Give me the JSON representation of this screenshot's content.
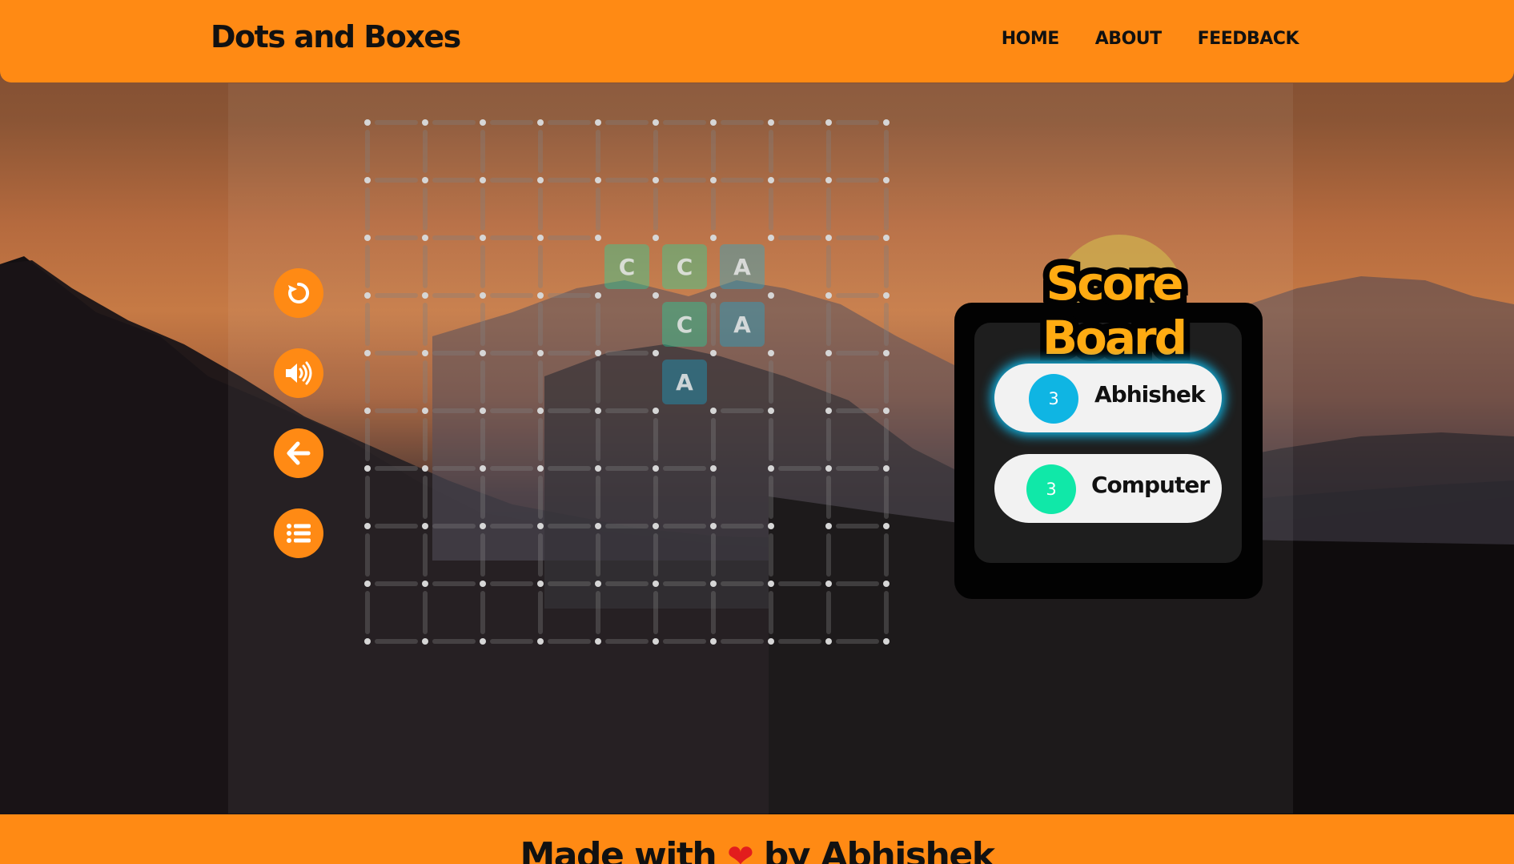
{
  "header": {
    "brand": "Dots and Boxes",
    "nav": [
      "HOME",
      "ABOUT",
      "FEEDBACK"
    ]
  },
  "side_controls": [
    {
      "name": "restart-button",
      "icon": "undo-icon"
    },
    {
      "name": "sound-button",
      "icon": "volume-icon"
    },
    {
      "name": "back-button",
      "icon": "arrow-left-icon"
    },
    {
      "name": "menu-button",
      "icon": "list-icon"
    }
  ],
  "colors": {
    "accent": "#ff8a14",
    "player_one": "#0fb5e3",
    "player_two": "#10e8a8",
    "title": "#ffab12"
  },
  "board": {
    "dots_per_side": 10,
    "horizontal_lines": [
      {
        "row": 2,
        "col": 4,
        "owner": "C"
      },
      {
        "row": 2,
        "col": 5,
        "owner": "C"
      },
      {
        "row": 2,
        "col": 6,
        "owner": "A"
      },
      {
        "row": 3,
        "col": 4,
        "owner": "C"
      },
      {
        "row": 3,
        "col": 5,
        "owner": "C"
      },
      {
        "row": 3,
        "col": 6,
        "owner": "A"
      },
      {
        "row": 3,
        "col": 7,
        "owner": "C"
      },
      {
        "row": 4,
        "col": 5,
        "owner": "A"
      },
      {
        "row": 4,
        "col": 6,
        "owner": "A"
      },
      {
        "row": 4,
        "col": 7,
        "owner": "A"
      },
      {
        "row": 5,
        "col": 5,
        "owner": "A"
      },
      {
        "row": 5,
        "col": 7,
        "owner": "C"
      },
      {
        "row": 6,
        "col": 6,
        "owner": "A"
      },
      {
        "row": 7,
        "col": 7,
        "owner": "C"
      }
    ],
    "vertical_lines": [
      {
        "row": 2,
        "col": 4,
        "owner": "C"
      },
      {
        "row": 2,
        "col": 5,
        "owner": "C"
      },
      {
        "row": 2,
        "col": 6,
        "owner": "A"
      },
      {
        "row": 2,
        "col": 7,
        "owner": "A"
      },
      {
        "row": 3,
        "col": 5,
        "owner": "C"
      },
      {
        "row": 3,
        "col": 7,
        "owner": "A"
      },
      {
        "row": 4,
        "col": 5,
        "owner": "A"
      },
      {
        "row": 4,
        "col": 6,
        "owner": "A"
      }
    ],
    "boxes": [
      {
        "row": 2,
        "col": 4,
        "label": "C",
        "owner": "C"
      },
      {
        "row": 2,
        "col": 5,
        "label": "C",
        "owner": "C"
      },
      {
        "row": 2,
        "col": 6,
        "label": "A",
        "owner": "A"
      },
      {
        "row": 3,
        "col": 5,
        "label": "C",
        "owner": "C"
      },
      {
        "row": 3,
        "col": 6,
        "label": "A",
        "owner": "A"
      },
      {
        "row": 4,
        "col": 5,
        "label": "A",
        "owner": "A"
      }
    ]
  },
  "scoreboard": {
    "title": "Score Board",
    "players": [
      {
        "name": "Abhishek",
        "score": "3",
        "color": "#0fb5e3",
        "active": true
      },
      {
        "name": "Computer",
        "score": "3",
        "color": "#10e8a8",
        "active": false
      }
    ]
  },
  "footer": {
    "before": "Made with",
    "heart": "❤",
    "after": "by Abhishek"
  }
}
